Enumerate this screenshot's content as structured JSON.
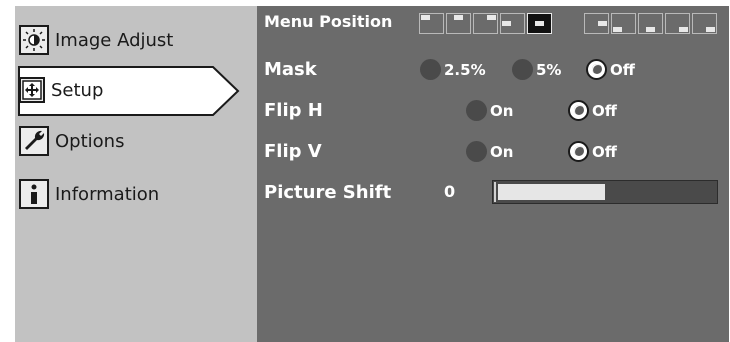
{
  "sidebar": {
    "items": [
      {
        "label": "Image Adjust",
        "icon": "brightness-icon"
      },
      {
        "label": "Setup",
        "icon": "move-arrows-icon"
      },
      {
        "label": "Options",
        "icon": "wrench-icon"
      },
      {
        "label": "Information",
        "icon": "info-icon"
      }
    ],
    "selected": "Setup"
  },
  "setup": {
    "menu_position": {
      "label": "Menu Position",
      "positions": [
        "top-left",
        "top-center",
        "top-right",
        "center-left",
        "center",
        "center-right",
        "bottom-left",
        "bottom-center",
        "bottom-right"
      ],
      "selected": "center"
    },
    "mask": {
      "label": "Mask",
      "options": [
        "2.5%",
        "5%",
        "Off"
      ],
      "selected": "Off"
    },
    "flip_h": {
      "label": "Flip H",
      "options": [
        "On",
        "Off"
      ],
      "selected": "Off"
    },
    "flip_v": {
      "label": "Flip V",
      "options": [
        "On",
        "Off"
      ],
      "selected": "Off"
    },
    "picture_shift": {
      "label": "Picture Shift",
      "value": "0",
      "level": 0.5
    }
  },
  "colors": {
    "panel": "#6b6b6b",
    "sidebar": "#c2c2c2",
    "text": "#ffffff"
  }
}
